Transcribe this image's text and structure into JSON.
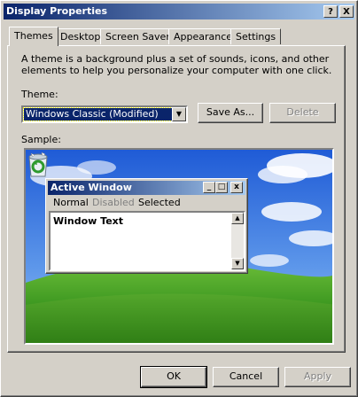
{
  "window": {
    "title": "Display Properties",
    "help_label": "?",
    "close_label": "X"
  },
  "tabs": [
    {
      "label": "Themes",
      "active": true
    },
    {
      "label": "Desktop",
      "active": false
    },
    {
      "label": "Screen Saver",
      "active": false
    },
    {
      "label": "Appearance",
      "active": false
    },
    {
      "label": "Settings",
      "active": false
    }
  ],
  "themes": {
    "description": "A theme is a background plus a set of sounds, icons, and other elements to help you personalize your computer with one click.",
    "theme_label": "Theme:",
    "theme_value": "Windows Classic (Modified)",
    "save_as_label": "Save As...",
    "delete_label": "Delete",
    "sample_label": "Sample:"
  },
  "preview": {
    "window_title": "Active Window",
    "menu": [
      "Normal",
      "Disabled",
      "Selected"
    ],
    "window_text": "Window Text",
    "minimize_glyph": "_",
    "maximize_glyph": "□",
    "close_glyph": "x",
    "scroll_up": "▲",
    "scroll_down": "▼",
    "desktop_icon": "recycle-bin-icon"
  },
  "footer": {
    "ok_label": "OK",
    "cancel_label": "Cancel",
    "apply_label": "Apply"
  },
  "colors": {
    "titlebar_start": "#0a246a",
    "titlebar_end": "#a6caf0",
    "face": "#d4d0c8"
  }
}
